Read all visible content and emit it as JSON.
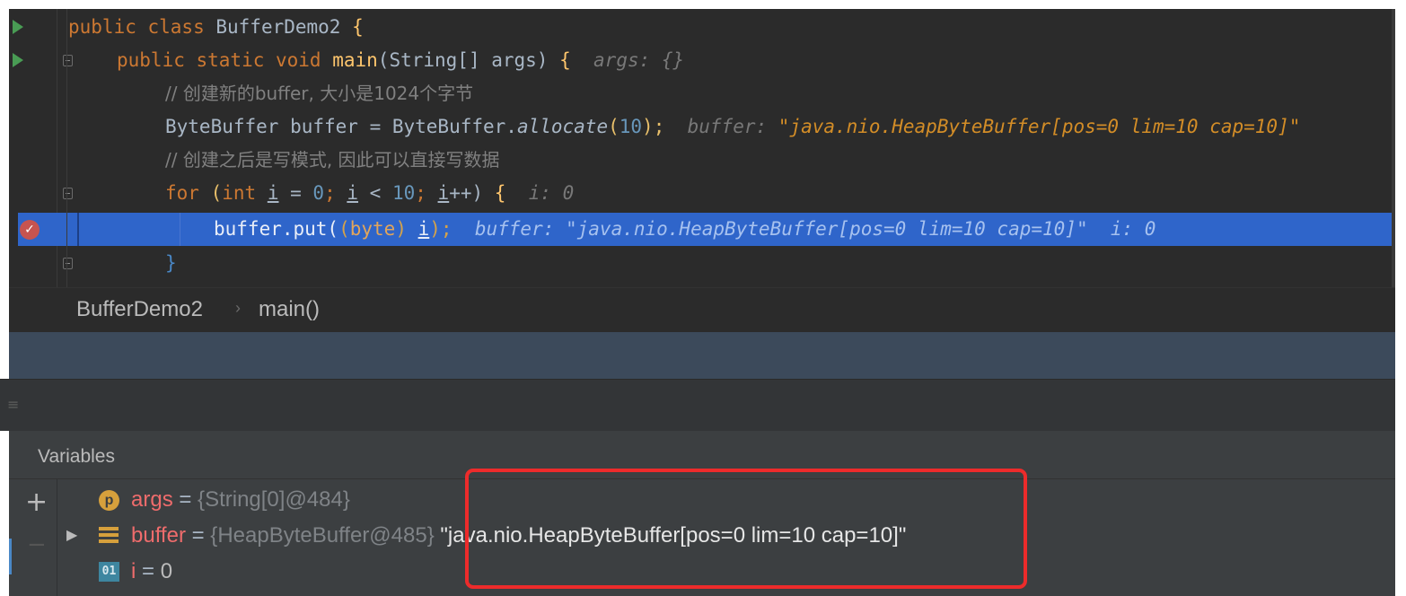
{
  "editor": {
    "lines": [
      {
        "id": "class-decl"
      },
      {
        "id": "main-decl"
      },
      {
        "id": "comment-1"
      },
      {
        "id": "allocate"
      },
      {
        "id": "comment-2"
      },
      {
        "id": "for-loop"
      },
      {
        "id": "put-call"
      },
      {
        "id": "close-brace"
      }
    ],
    "class_decl": {
      "kw1": "public class ",
      "name": "BufferDemo2",
      "brace": " {"
    },
    "main_decl": {
      "kw": "public static void ",
      "name": "main",
      "sig": "(String[] args) ",
      "brace": "{",
      "hint": "  args: {}"
    },
    "comment_1": "// 创建新的buffer, 大小是1024个字节",
    "allocate": {
      "lhs": "ByteBuffer buffer = ByteBuffer.",
      "call": "allocate",
      "open": "(",
      "num": "10",
      "close": ");",
      "hint_label": "  buffer: ",
      "hint_value": "\"java.nio.HeapByteBuffer[pos=0 lim=10 cap=10]\""
    },
    "comment_2": "// 创建之后是写模式, 因此可以直接写数据",
    "for_loop": {
      "kw": "for ",
      "open": "(",
      "int": "int ",
      "i1": "i",
      "eq": " = ",
      "zero": "0",
      "semi1": "; ",
      "i2": "i",
      "lt": " < ",
      "ten": "10",
      "semi2": "; ",
      "i3": "i",
      "inc": "++) ",
      "brace": "{",
      "hint": "  i: 0"
    },
    "put_call": {
      "pre": "buffer.put(",
      "cast_open": "(",
      "cast": "byte",
      "cast_close": ") ",
      "var": "i",
      "close": ");",
      "hint_label": "  buffer: ",
      "hint_value": "\"java.nio.HeapByteBuffer[pos=0 lim=10 cap=10]\"",
      "hint_i": "  i: 0"
    },
    "close_brace": "}"
  },
  "breadcrumb": {
    "items": [
      "BufferDemo2",
      "main()"
    ],
    "separator": "›"
  },
  "toolbar": {
    "icon": "restore-layout-icon"
  },
  "variables": {
    "title": "Variables",
    "add_glyph": "+",
    "remove_glyph": "−",
    "rows": [
      {
        "icon": "p",
        "name": "args",
        "eq": " = ",
        "value": "{String[0]@484}",
        "expandable": false
      },
      {
        "icon": "field",
        "name": "buffer",
        "eq": " = ",
        "value": "{HeapByteBuffer@485}",
        "string": " \"java.nio.HeapByteBuffer[pos=0 lim=10 cap=10]\"",
        "expandable": true
      },
      {
        "icon": "01",
        "name": "i",
        "eq": " = ",
        "value": "0",
        "expandable": false
      }
    ]
  },
  "colors": {
    "highlight": "#2f65ca",
    "annotation": "#ed2b2b",
    "editor_bg": "#2b2b2b",
    "panel_bg": "#3c3f41"
  }
}
